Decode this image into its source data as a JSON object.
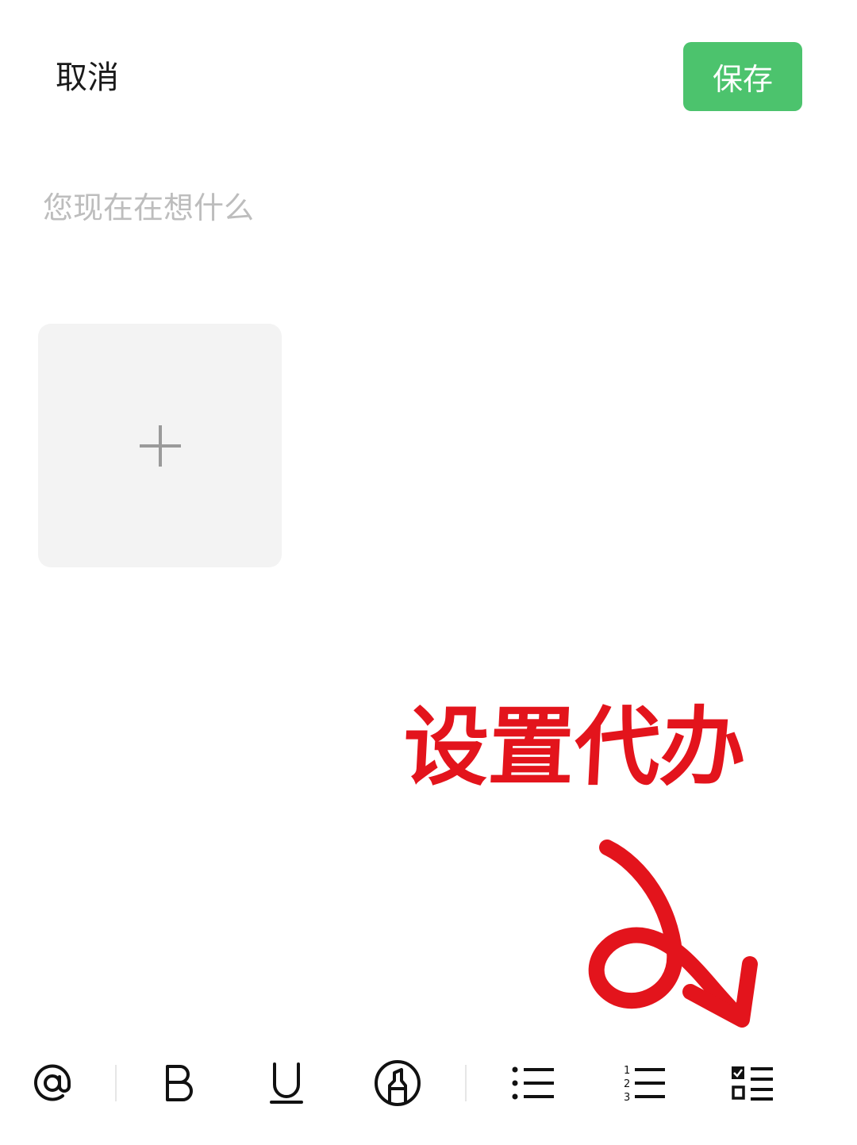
{
  "header": {
    "cancel_label": "取消",
    "save_label": "保存"
  },
  "editor": {
    "placeholder": "您现在在想什么"
  },
  "annotation": {
    "label": "设置代办"
  },
  "toolbar": {
    "items": [
      {
        "name": "mention",
        "icon": "at-icon"
      },
      {
        "name": "bold",
        "icon": "bold-icon"
      },
      {
        "name": "underline",
        "icon": "underline-icon"
      },
      {
        "name": "highlight",
        "icon": "highlighter-icon"
      },
      {
        "name": "bullet-list",
        "icon": "bullet-list-icon"
      },
      {
        "name": "numbered-list",
        "icon": "numbered-list-icon"
      },
      {
        "name": "todo-list",
        "icon": "checklist-icon"
      }
    ]
  },
  "colors": {
    "save_button": "#4cc36d",
    "annotation": "#e3141c",
    "placeholder": "#bdbdbd",
    "tile": "#f3f3f3"
  }
}
